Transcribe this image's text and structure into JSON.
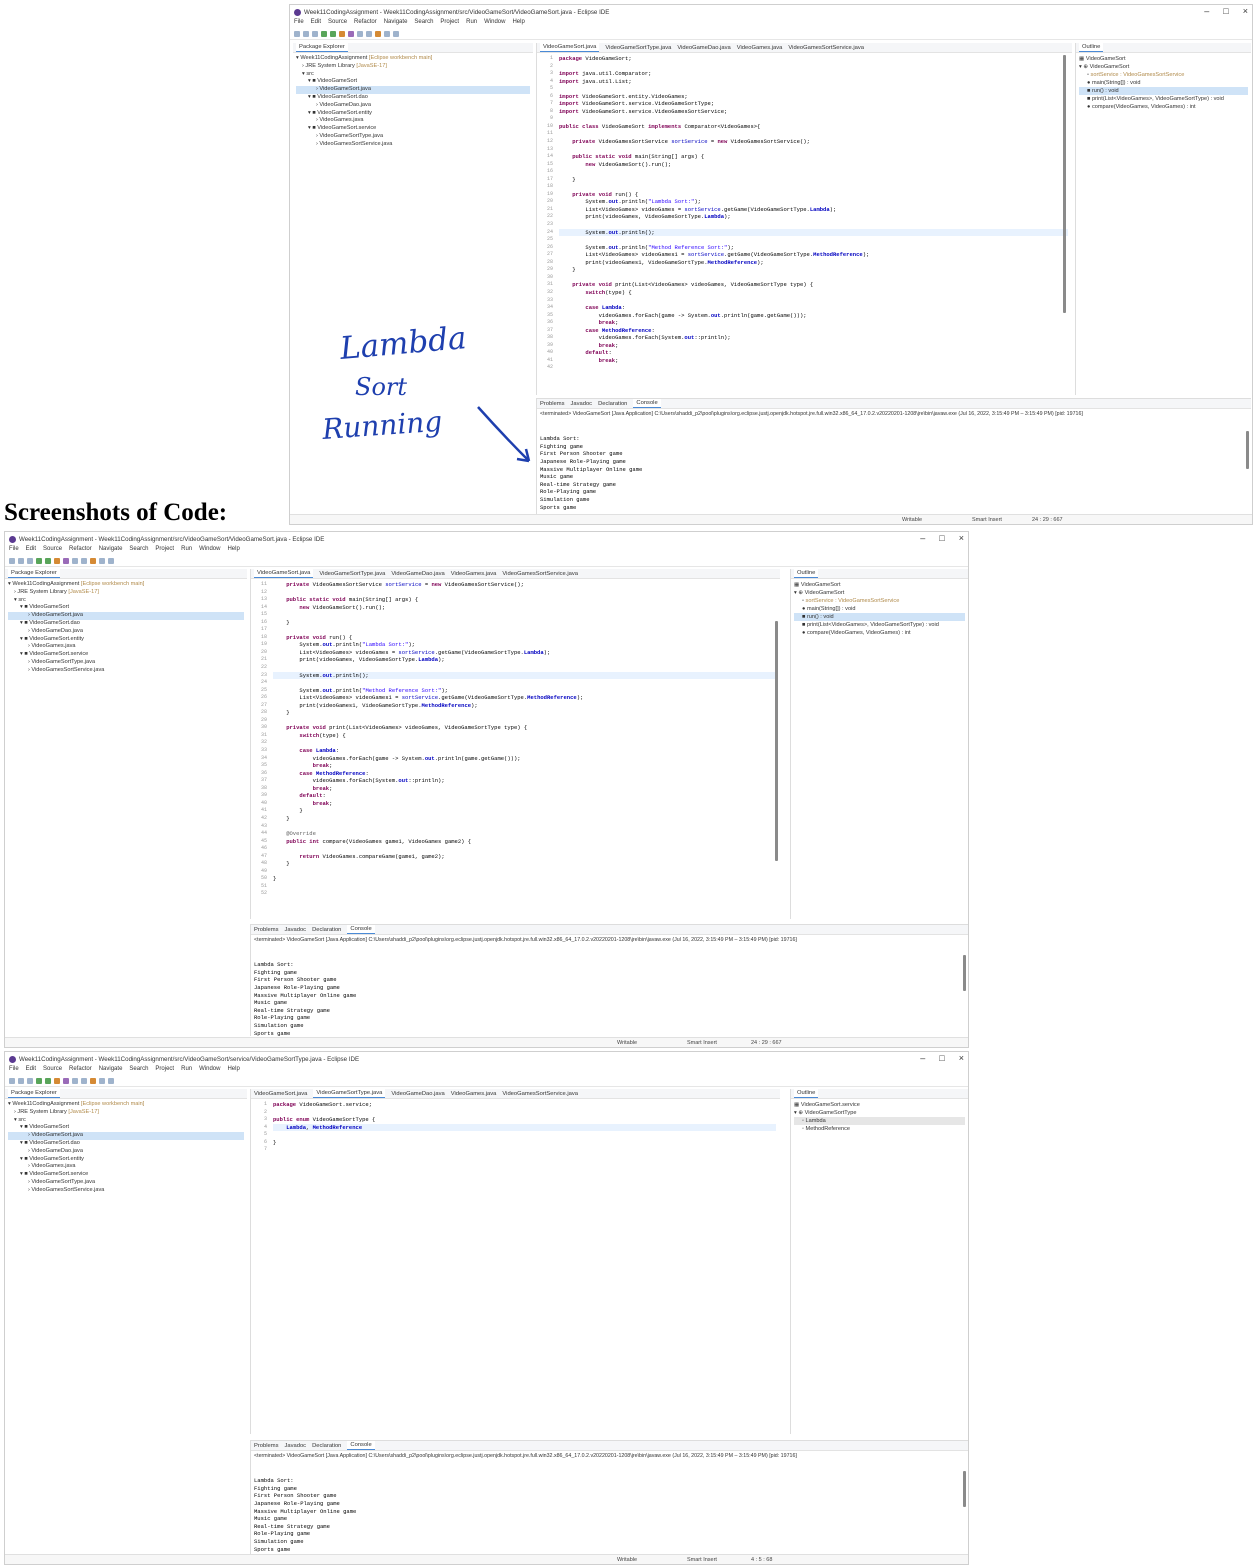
{
  "caption": "Screenshots of Code:",
  "menu": [
    "File",
    "Edit",
    "Source",
    "Refactor",
    "Navigate",
    "Search",
    "Project",
    "Run",
    "Window",
    "Help"
  ],
  "window_controls": {
    "minimize": "–",
    "maximize": "□",
    "close": "×"
  },
  "package_explorer": {
    "title": "Package Explorer",
    "project": "Week11CodingAssignment",
    "project_tag": "[Eclipse workbench main]",
    "jre": "JRE System Library",
    "jre_tag": "[JavaSE-17]",
    "src": "src",
    "items": [
      "VideoGameSort",
      "VideoGameSort.java",
      "VideoGameSort.dao",
      "VideoGameDao.java",
      "VideoGameSort.entity",
      "VideoGames.java",
      "VideoGameSort.service",
      "VideoGameSortType.java",
      "VideoGamesSortService.java"
    ]
  },
  "console": {
    "tabs": [
      "Problems",
      "Javadoc",
      "Declaration",
      "Console"
    ],
    "terminated": "<terminated> VideoGameSort [Java Application] C:\\Users\\shaddi_p2\\pool\\plugins\\org.eclipse.justj.openjdk.hotspot.jre.full.win32.x86_64_17.0.2.v20220201-1208\\jre\\bin\\javaw.exe (Jul 16, 2022, 3:15:49 PM – 3:15:49 PM) [pid: 19716]",
    "lines": [
      "Lambda Sort:",
      "Fighting game",
      "First Person Shooter game",
      "Japanese Role-Playing game",
      "Massive Multiplayer Online game",
      "Music game",
      "Real-time Strategy game",
      "Role-Playing game",
      "Simulation game",
      "Sports game"
    ]
  },
  "status": {
    "writable": "Writable",
    "insert": "Smart Insert",
    "pos1": "24 : 29 : 667",
    "pos3": "4 : 5 : 68"
  },
  "outline_title": "Outline",
  "handwriting": {
    "line1": "Lambda",
    "line2": "Sort",
    "line3": "Running"
  },
  "shots": [
    {
      "title": "Week11CodingAssignment - Week11CodingAssignment/src/VideoGameSort/VideoGameSort.java - Eclipse IDE",
      "tabs": [
        "VideoGameSort.java",
        "VideoGameSortType.java",
        "VideoGameDao.java",
        "VideoGames.java",
        "VideoGamesSortService.java"
      ],
      "line_numbers": "1\n2\n3\n4\n5\n6\n7\n8\n9\n10\n11\n12\n13\n14\n15\n16\n17\n18\n19\n20\n21\n22\n23\n24\n25\n26\n27\n28\n29\n30\n31\n32\n33\n34\n35\n36\n37\n38\n39\n40\n41\n42",
      "outline": [
        "VideoGameSort",
        "VideoGameSort",
        "sortService : VideoGamesSortService",
        "main(String[]) : void",
        "run() : void",
        "print(List<VideoGames>, VideoGameSortType) : void",
        "compare(VideoGames, VideoGames) : int"
      ]
    },
    {
      "title": "Week11CodingAssignment - Week11CodingAssignment/src/VideoGameSort/VideoGameSort.java - Eclipse IDE",
      "tabs": [
        "VideoGameSort.java",
        "VideoGameSortType.java",
        "VideoGameDao.java",
        "VideoGames.java",
        "VideoGamesSortService.java"
      ],
      "line_numbers": "11\n12\n13\n14\n15\n16\n17\n18\n19\n20\n21\n22\n23\n24\n25\n26\n27\n28\n29\n30\n31\n32\n33\n34\n35\n36\n37\n38\n39\n40\n41\n42\n43\n44\n45\n46\n47\n48\n49\n50\n51\n52",
      "outline": [
        "VideoGameSort",
        "VideoGameSort",
        "sortService : VideoGamesSortService",
        "main(String[]) : void",
        "run() : void",
        "print(List<VideoGames>, VideoGameSortType) : void",
        "compare(VideoGames, VideoGames) : int"
      ]
    },
    {
      "title": "Week11CodingAssignment - Week11CodingAssignment/src/VideoGameSort/service/VideoGameSortType.java - Eclipse IDE",
      "tabs": [
        "VideoGameSort.java",
        "VideoGameSortType.java",
        "VideoGameDao.java",
        "VideoGames.java",
        "VideoGamesSortService.java"
      ],
      "line_numbers": "1\n2\n3\n4\n5\n6\n7",
      "outline": [
        "VideoGameSort.service",
        "VideoGameSortType",
        "Lambda",
        "MethodReference"
      ]
    }
  ]
}
